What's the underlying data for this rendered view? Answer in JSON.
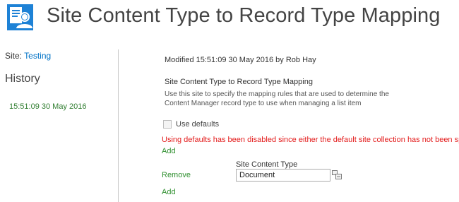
{
  "header": {
    "title": "Site Content Type to Record Type Mapping",
    "logo_icon": "document-user-icon",
    "logo_color": "#1e82d6"
  },
  "sidebar": {
    "site_label": "Site:",
    "site_name": "Testing",
    "history_heading": "History",
    "history_items": [
      "15:51:09 30 May 2016"
    ]
  },
  "main": {
    "modified": "Modified 15:51:09 30 May 2016 by Rob Hay",
    "section_title": "Site Content Type to Record Type Mapping",
    "section_description": "Use this site to specify the mapping rules that are used to determine the Content Manager record type to use when managing a list item",
    "use_defaults_label": "Use defaults",
    "use_defaults_checked": false,
    "error_message": "Using defaults has been disabled since either the default site collection has not been specified o",
    "add_label": "Add",
    "remove_label": "Remove",
    "column_header": "Site Content Type",
    "content_type_value": "Document",
    "browse_icon": "browse-picker-icon",
    "link_color": "#2f8f2f",
    "error_color": "#e31b1b"
  }
}
